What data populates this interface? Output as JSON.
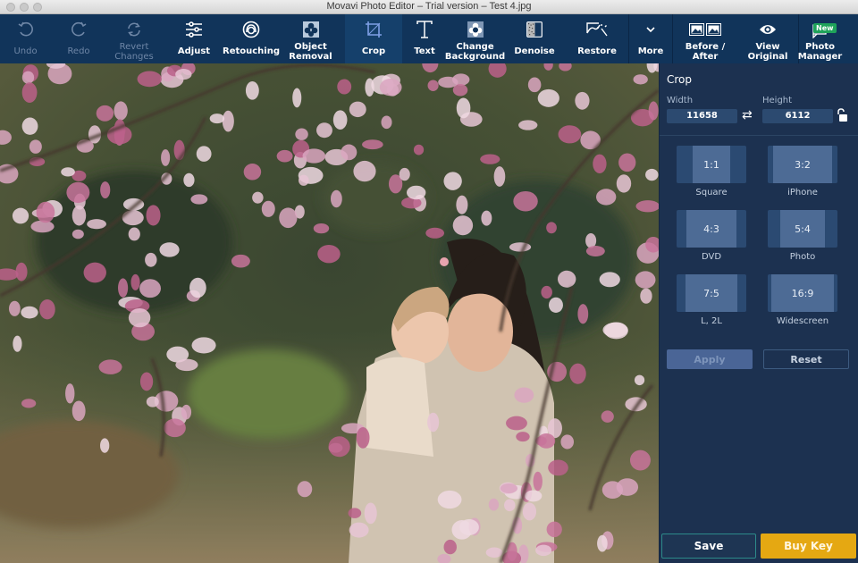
{
  "window": {
    "title": "Movavi Photo Editor – Trial version – Test 4.jpg"
  },
  "toolbar": {
    "items": [
      {
        "id": "undo",
        "label": "Undo",
        "icon": "undo-icon",
        "enabled": false
      },
      {
        "id": "redo",
        "label": "Redo",
        "icon": "redo-icon",
        "enabled": false
      },
      {
        "id": "revert",
        "label": "Revert Changes",
        "icon": "revert-icon",
        "enabled": false
      },
      {
        "id": "adjust",
        "label": "Adjust",
        "icon": "sliders-icon",
        "enabled": true
      },
      {
        "id": "retouching",
        "label": "Retouching",
        "icon": "face-icon",
        "enabled": true
      },
      {
        "id": "object-removal",
        "label": "Object Removal",
        "icon": "object-removal-icon",
        "enabled": true
      },
      {
        "id": "crop",
        "label": "Crop",
        "icon": "crop-icon",
        "enabled": true,
        "active": true
      },
      {
        "id": "text",
        "label": "Text",
        "icon": "text-icon",
        "enabled": true
      },
      {
        "id": "change-background",
        "label": "Change Background",
        "icon": "change-background-icon",
        "enabled": true
      },
      {
        "id": "denoise",
        "label": "Denoise",
        "icon": "denoise-icon",
        "enabled": true
      },
      {
        "id": "restore",
        "label": "Restore",
        "icon": "restore-icon",
        "enabled": true
      },
      {
        "id": "more",
        "label": "More",
        "icon": "chevron-down-icon",
        "enabled": true
      },
      {
        "id": "before-after",
        "label": "Before / After",
        "icon": "before-after-icon",
        "enabled": true
      },
      {
        "id": "view-original",
        "label": "View Original",
        "icon": "eye-icon",
        "enabled": true
      },
      {
        "id": "photo-manager",
        "label": "Photo Manager",
        "icon": "photo-manager-icon",
        "enabled": true,
        "badge": "New"
      }
    ]
  },
  "crop_panel": {
    "title": "Crop",
    "width_label": "Width",
    "height_label": "Height",
    "width_value": "11658",
    "height_value": "6112",
    "presets": [
      {
        "ratio": "1:1",
        "name": "Square"
      },
      {
        "ratio": "3:2",
        "name": "iPhone"
      },
      {
        "ratio": "4:3",
        "name": "DVD"
      },
      {
        "ratio": "5:4",
        "name": "Photo"
      },
      {
        "ratio": "7:5",
        "name": "L, 2L"
      },
      {
        "ratio": "16:9",
        "name": "Widescreen"
      }
    ],
    "apply_label": "Apply",
    "reset_label": "Reset"
  },
  "footer": {
    "save_label": "Save",
    "buy_label": "Buy Key"
  },
  "colors": {
    "toolbar_bg": "#11345a",
    "panel_bg": "#1c3150",
    "accent_buy": "#e5a812",
    "badge_new": "#1fa35a"
  }
}
